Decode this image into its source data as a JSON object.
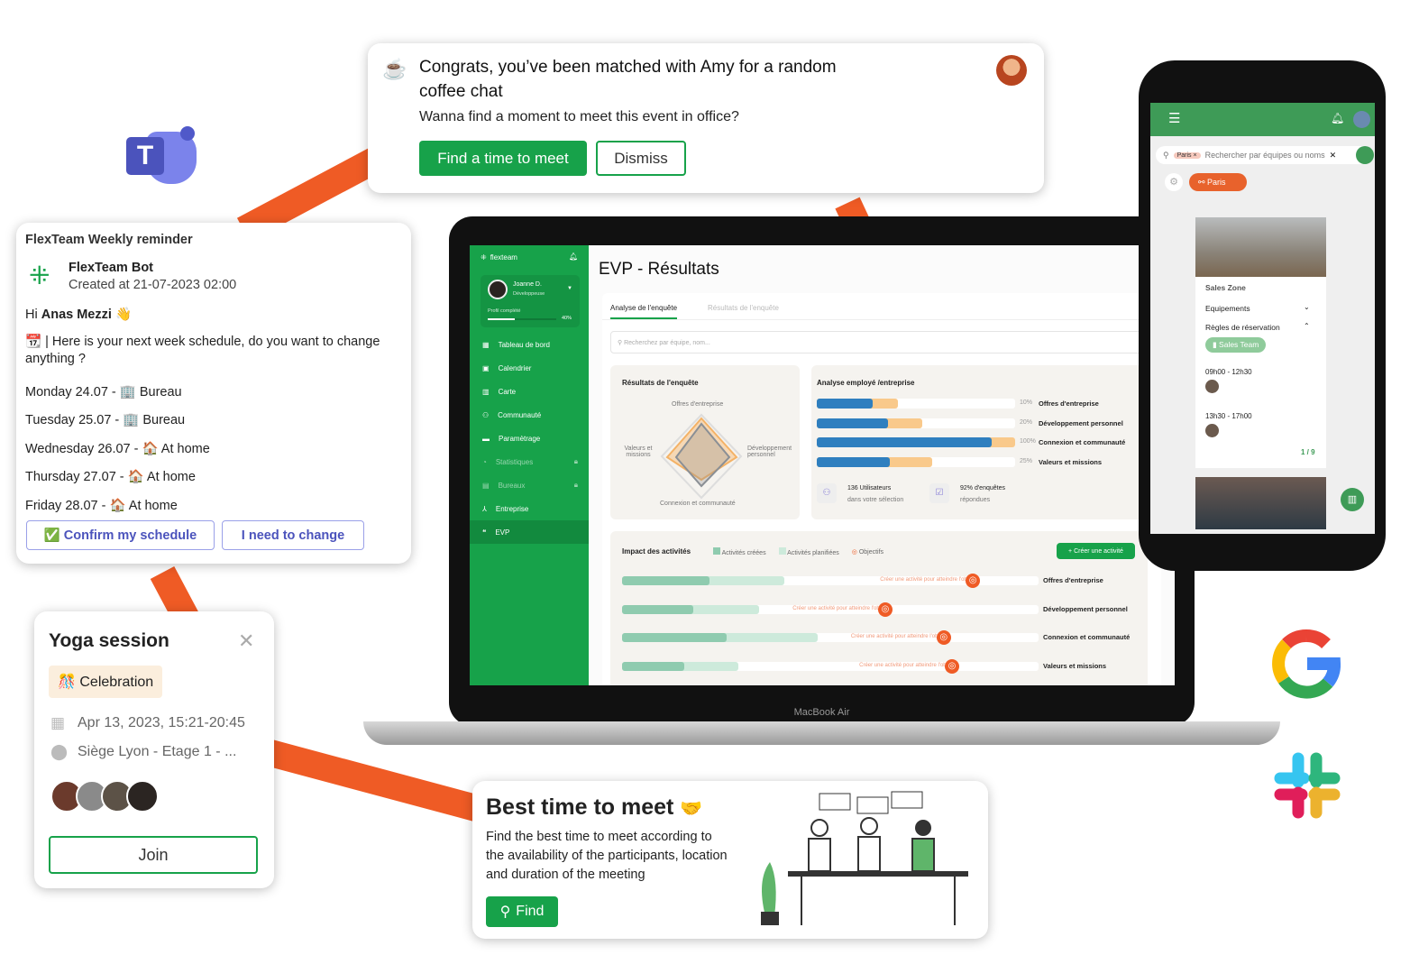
{
  "coffee": {
    "title": "Congrats, you’ve been matched with Amy for a random coffee chat",
    "body": "Wanna find a moment to meet this event in office?",
    "primary": "Find a time to meet",
    "secondary": "Dismiss"
  },
  "reminder": {
    "title": "FlexTeam Weekly reminder",
    "bot": "FlexTeam Bot",
    "created": "Created at 21-07-2023 02:00",
    "greeting_prefix": "Hi ",
    "user": "Anas Mezzi",
    "wave": "👋",
    "intro": "📆 | Here is your next week schedule, do you want to change anything ?",
    "days": [
      "Monday 24.07 - 🏢 Bureau",
      "Tuesday 25.07 - 🏢 Bureau",
      "Wednesday 26.07 - 🏠 At home",
      "Thursday 27.07 - 🏠 At home",
      "Friday 28.07 - 🏠 At home"
    ],
    "confirm": "✅ Confirm my schedule",
    "change": "I need to change"
  },
  "yoga": {
    "title": "Yoga session",
    "tag": "🎊 Celebration",
    "date": "Apr 13, 2023, 15:21-20:45",
    "location": "Siège Lyon - Etage 1 - ...",
    "join": "Join"
  },
  "besttime": {
    "title": "Best time to meet",
    "emoji": "🤝",
    "body": "Find the best time to meet according to the availability of the participants, location and duration of the meeting",
    "find": "Find"
  },
  "laptop": {
    "label": "MacBook Air",
    "brand": "flexteam",
    "user": {
      "name": "Joanne D.",
      "role": "Développeuse",
      "profile_label": "Profil complété",
      "profile_pct": "40%",
      "profile_value": 0.4
    },
    "nav": [
      {
        "label": "Tableau de bord"
      },
      {
        "label": "Calendrier"
      },
      {
        "label": "Carte"
      },
      {
        "label": "Communauté"
      },
      {
        "label": "Paramètrage"
      },
      {
        "label": "Statistiques",
        "locked": true
      },
      {
        "label": "Bureaux",
        "locked": true
      },
      {
        "label": "Entreprise"
      },
      {
        "label": "EVP",
        "active": true
      }
    ],
    "page_title": "EVP - Résultats",
    "tabs": [
      "Analyse de l'enquête",
      "Résultats de l'enquête"
    ],
    "search_placeholder": "Recherchez par équipe, nom...",
    "radar": {
      "title": "Résultats de l'enquête",
      "axes": [
        "Offres d'entreprise",
        "Développement personnel",
        "Connexion et communauté",
        "Valeurs et missions"
      ]
    },
    "analysis": {
      "title": "Analyse employé /entreprise",
      "rows": [
        {
          "pct": "10%",
          "label": "Offres d'entreprise",
          "company": 0.28,
          "employee": 0.41
        },
        {
          "pct": "20%",
          "label": "Développement personnel",
          "company": 0.36,
          "employee": 0.53
        },
        {
          "pct": "100%",
          "label": "Connexion et communauté",
          "company": 0.88,
          "employee": 1.0
        },
        {
          "pct": "25%",
          "label": "Valeurs et missions",
          "company": 0.37,
          "employee": 0.58
        }
      ],
      "users_count": "136 Utilisateurs",
      "users_sub": "dans votre sélection",
      "surveys": "92% d'enquêtes",
      "surveys_sub": "répondues"
    },
    "impact": {
      "title": "Impact des activités",
      "legend": [
        "Activités créées",
        "Activités planifiées",
        "Objectifs"
      ],
      "create": "+ Créer une activité",
      "cta": "Créer une activité pour atteindre l'objectif",
      "rows": [
        {
          "label": "Offres d'entreprise",
          "created": 0.21,
          "planned": 0.39,
          "goal": 0.84
        },
        {
          "label": "Développement personnel",
          "created": 0.17,
          "planned": 0.33,
          "goal": 0.63
        },
        {
          "label": "Connexion et communauté",
          "created": 0.25,
          "planned": 0.47,
          "goal": 0.77
        },
        {
          "label": "Valeurs et missions",
          "created": 0.15,
          "planned": 0.28,
          "goal": 0.79
        }
      ]
    }
  },
  "phone": {
    "chip": "Paris ×",
    "search_placeholder": "Rechercher par équipes ou noms",
    "location": "Paris",
    "zone": "Sales Zone",
    "equipements": "Equipements",
    "rules": "Règles de réservation",
    "team": "Sales Team",
    "slots": [
      "09h00 - 12h30",
      "13h30 - 17h00"
    ],
    "pager": "1 / 9"
  },
  "colors": {
    "brand": "#17a24a",
    "accent": "#ef5b25",
    "company": "#2f7fbf",
    "employee": "#f9c98b"
  }
}
